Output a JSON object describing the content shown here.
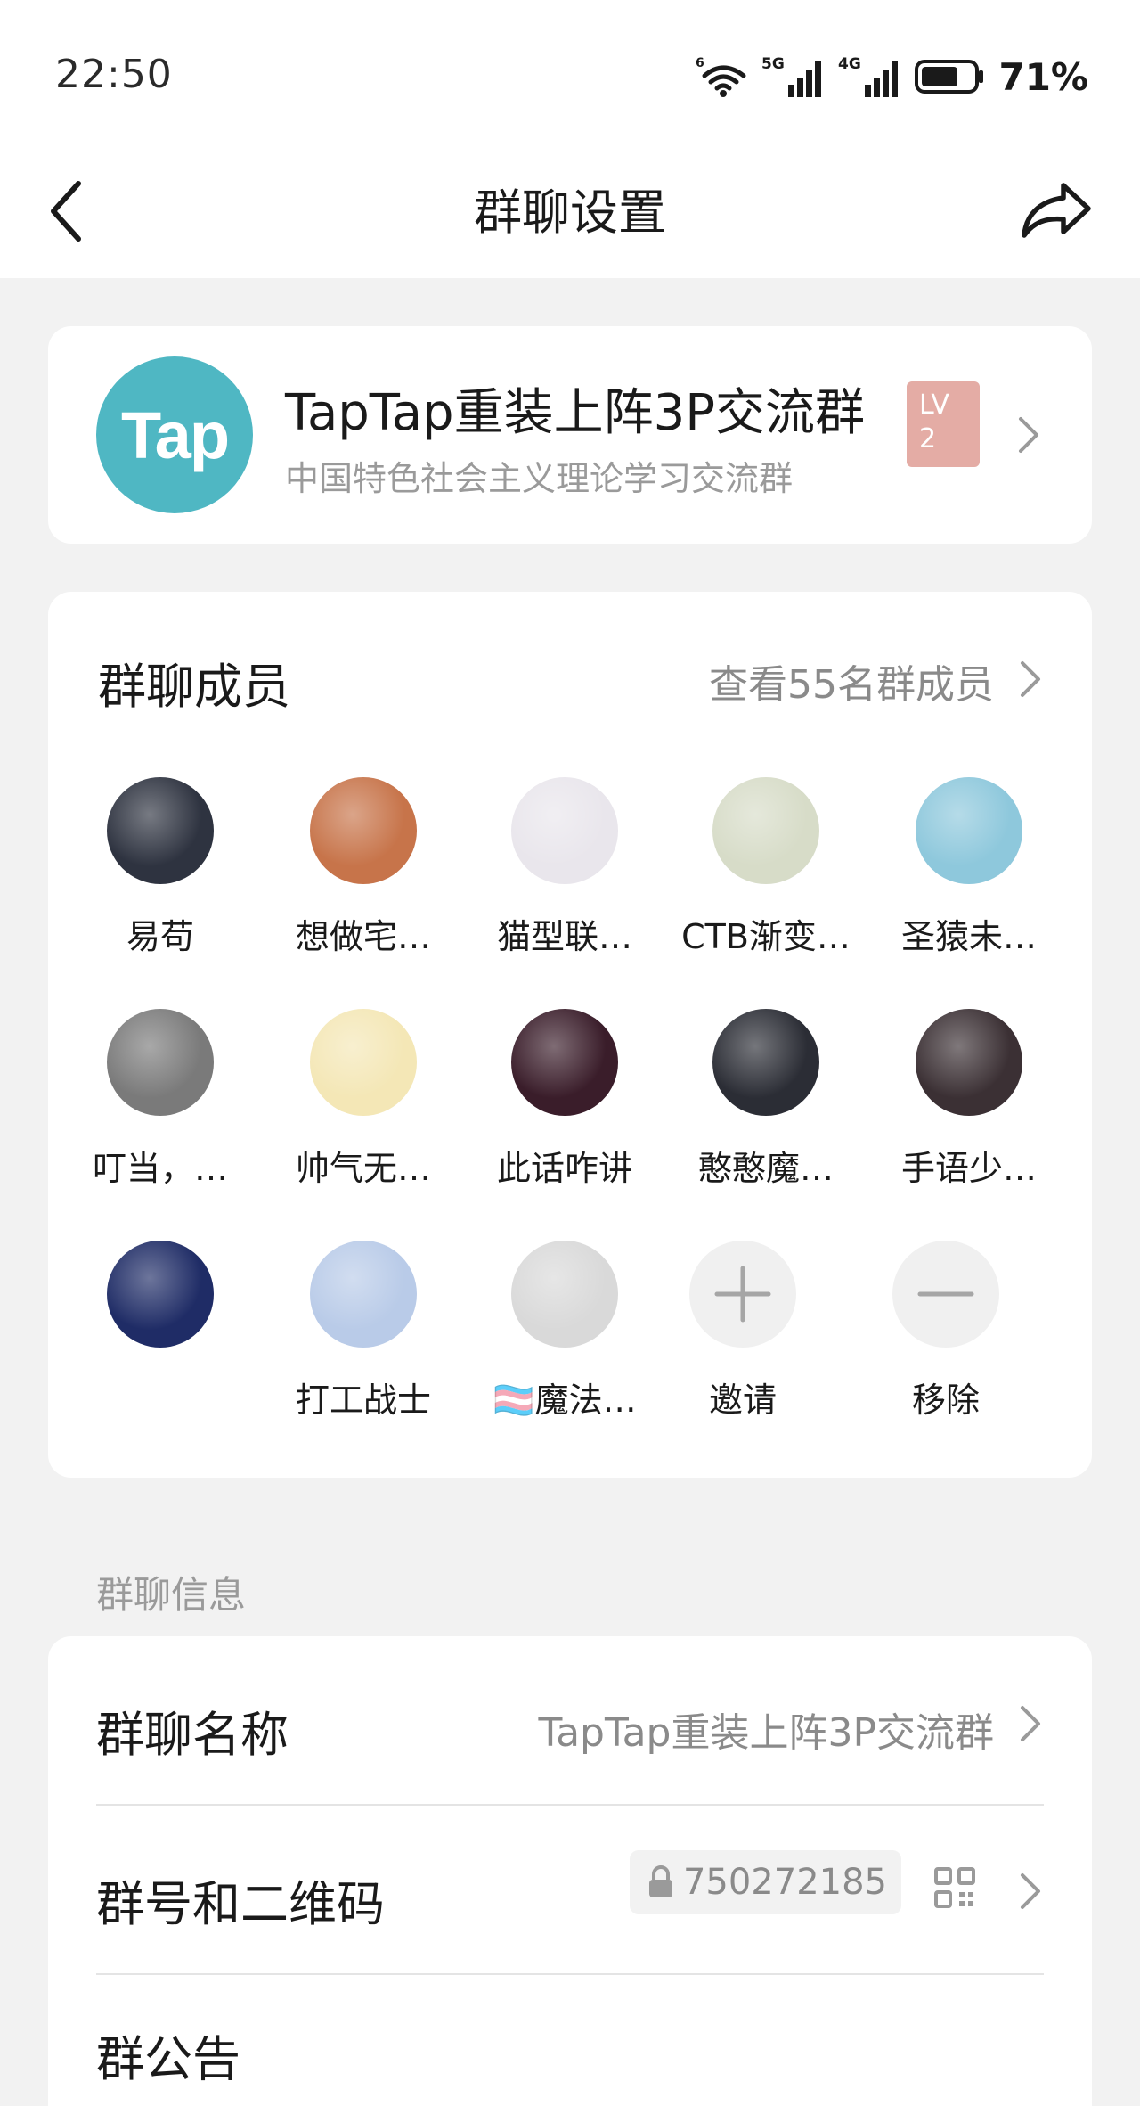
{
  "status_bar": {
    "time": "22:50",
    "battery_percent": "71%",
    "signal_labels": {
      "wifi": "6",
      "sim1": "5G",
      "sim2": "4G"
    },
    "battery_level": 0.71
  },
  "nav": {
    "title": "群聊设置",
    "back_icon": "chevron-left-icon",
    "share_icon": "share-arrow-icon"
  },
  "group": {
    "logo_text": "Tap",
    "name": "TapTap重装上阵3P交流群",
    "description": "中国特色社会主义理论学习交流群",
    "level_badge": {
      "prefix": "LV",
      "level": "2"
    },
    "logo_color": "#4fb7c3",
    "badge_color": "#e4aca5"
  },
  "members": {
    "title": "群聊成员",
    "view_all": "查看55名群成员",
    "list": [
      {
        "name": "易苟",
        "avatar_color": "#2e3340"
      },
      {
        "name": "想做宅…",
        "avatar_color": "#c7744a"
      },
      {
        "name": "猫型联…",
        "avatar_color": "#e9e6ec"
      },
      {
        "name": "CTB渐变…",
        "avatar_color": "#d7dcc8"
      },
      {
        "name": "圣猿未…",
        "avatar_color": "#8ec8dc"
      },
      {
        "name": "叮当，…",
        "avatar_color": "#7a7a7a"
      },
      {
        "name": "帅气无…",
        "avatar_color": "#f4e7b6"
      },
      {
        "name": "此话咋讲",
        "avatar_color": "#3a1d2a"
      },
      {
        "name": "憨憨魔…",
        "avatar_color": "#2b2d35"
      },
      {
        "name": "手语少…",
        "avatar_color": "#3b3034"
      },
      {
        "name": "",
        "avatar_color": "#1f2c66"
      },
      {
        "name": "打工战士",
        "avatar_color": "#b9cbe8"
      },
      {
        "name": "🏳️‍⚧️魔法…",
        "avatar_color": "#d9d9d9"
      }
    ],
    "invite_label": "邀请",
    "remove_label": "移除"
  },
  "info_section": {
    "label": "群聊信息",
    "group_name_label": "群聊名称",
    "group_name_value": "TapTap重装上阵3P交流群",
    "group_id_label": "群号和二维码",
    "group_id_value": "750272185",
    "announcement_label": "群公告"
  }
}
